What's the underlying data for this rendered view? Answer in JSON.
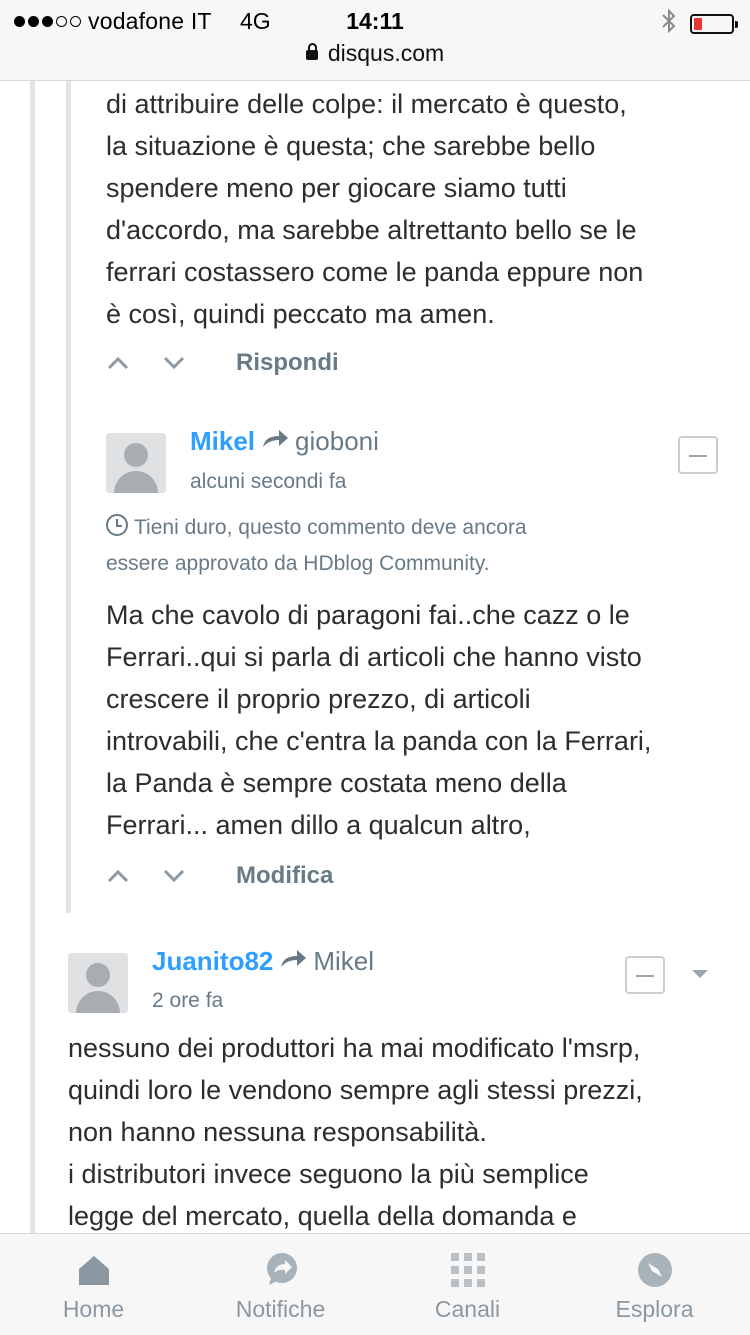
{
  "status_bar": {
    "carrier": "vodafone IT",
    "network": "4G",
    "time": "14:11",
    "battery_level_percent": 10,
    "url": "disqus.com"
  },
  "comments": [
    {
      "id": "prev",
      "text_lines": [
        "di attribuire delle colpe: il mercato è questo,",
        "la situazione è questa; che sarebbe bello",
        "spendere meno per giocare siamo tutti",
        "d'accordo, ma sarebbe altrettanto bello se le",
        "ferrari costassero come le panda eppure non",
        "è così, quindi peccato ma amen."
      ],
      "action_label": "Rispondi"
    },
    {
      "id": "mikel",
      "author": "Mikel",
      "reply_to": "gioboni",
      "time": "alcuni secondi fa",
      "pending_lines": [
        "Tieni duro, questo commento deve ancora",
        "essere approvato da HDblog Community."
      ],
      "text_lines": [
        "Ma che cavolo di paragoni fai..che cazz o le",
        "Ferrari..qui si parla di articoli che hanno visto",
        "crescere il proprio prezzo, di articoli",
        "introvabili, che c'entra la panda con la Ferrari,",
        "la Panda è sempre costata meno della",
        "Ferrari... amen dillo a qualcun altro,"
      ],
      "action_label": "Modifica"
    },
    {
      "id": "juanito",
      "author": "Juanito82",
      "reply_to": "Mikel",
      "time": "2 ore fa",
      "text_lines": [
        "nessuno dei produttori ha mai modificato l'msrp,",
        "quindi loro le vendono sempre agli stessi prezzi,",
        "non hanno nessuna responsabilità.",
        "i distributori invece seguono la più semplice",
        "legge del mercato, quella della domanda e"
      ]
    }
  ],
  "tabs": [
    {
      "label": "Home",
      "icon": "home-icon"
    },
    {
      "label": "Notifiche",
      "icon": "notifications-icon"
    },
    {
      "label": "Canali",
      "icon": "channels-grid-icon"
    },
    {
      "label": "Esplora",
      "icon": "compass-icon"
    }
  ],
  "colors": {
    "author": "#2e9fff",
    "muted": "#687a86",
    "body_text": "#2a2e2e",
    "tab": "#8b98a2"
  }
}
